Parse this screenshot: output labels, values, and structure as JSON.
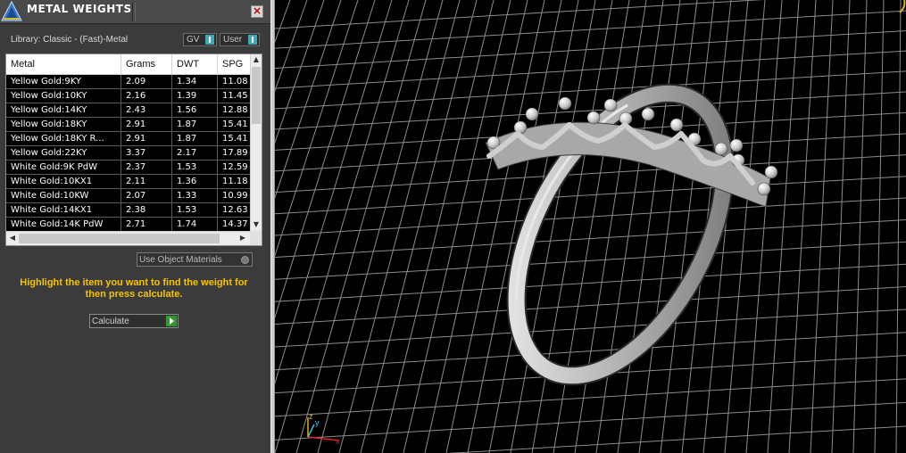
{
  "panel": {
    "title": "METAL WEIGHTS",
    "close_glyph": "×",
    "logo_icon": "app-logo-icon",
    "library_label": "Library: Classic - (Fast)-Metal",
    "toggles": {
      "gv": "GV",
      "user": "User"
    }
  },
  "table": {
    "columns": [
      "Metal",
      "Grams",
      "DWT",
      "SPG"
    ],
    "rows": [
      [
        "Yellow Gold:9KY",
        "2.09",
        "1.34",
        "11.08"
      ],
      [
        "Yellow Gold:10KY",
        "2.16",
        "1.39",
        "11.45"
      ],
      [
        "Yellow Gold:14KY",
        "2.43",
        "1.56",
        "12.88"
      ],
      [
        "Yellow Gold:18KY",
        "2.91",
        "1.87",
        "15.41"
      ],
      [
        "Yellow Gold:18KY R...",
        "2.91",
        "1.87",
        "15.41"
      ],
      [
        "Yellow Gold:22KY",
        "3.37",
        "2.17",
        "17.89"
      ],
      [
        "White Gold:9K PdW",
        "2.37",
        "1.53",
        "12.59"
      ],
      [
        "White Gold:10KX1",
        "2.11",
        "1.36",
        "11.18"
      ],
      [
        "White Gold:10KW",
        "2.07",
        "1.33",
        "10.99"
      ],
      [
        "White Gold:14KX1",
        "2.38",
        "1.53",
        "12.63"
      ],
      [
        "White Gold:14K PdW",
        "2.71",
        "1.74",
        "14.37"
      ]
    ],
    "scroll_up_glyph": "▲",
    "scroll_down_glyph": "▼",
    "scroll_left_glyph": "◀",
    "scroll_right_glyph": "▶"
  },
  "use_object_materials": "Use Object Materials",
  "instructions": "Highlight the item you want to find the weight for then press calculate.",
  "calculate_button": "Calculate",
  "viewport": {
    "background": "#000000",
    "grid_color": "#8c8c8c",
    "axis_labels": {
      "y": "y",
      "z": "z",
      "x": "x"
    },
    "axis_colors": {
      "x": "#e02020",
      "y": "#36c8e0",
      "z": "#e0b020"
    }
  }
}
